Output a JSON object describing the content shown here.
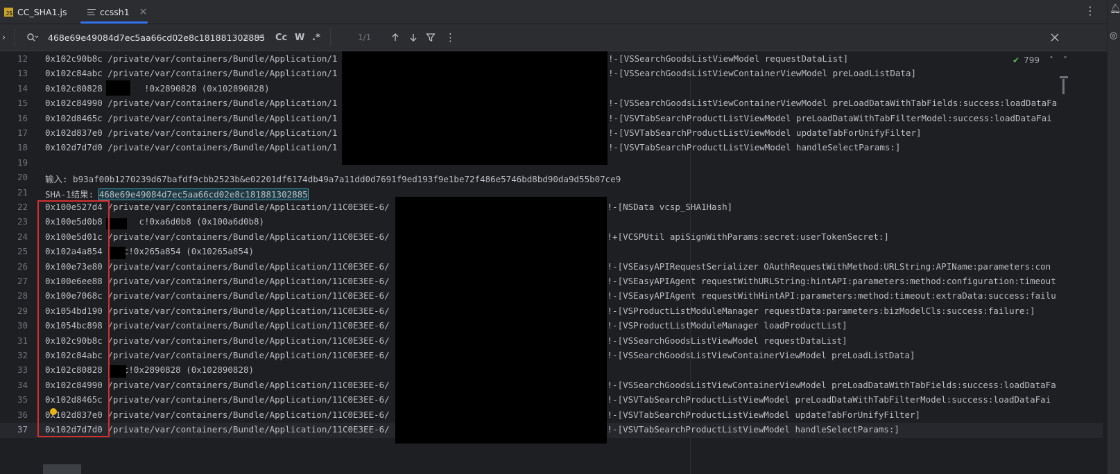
{
  "tabs": [
    {
      "label": "CC_SHA1.js",
      "icon": "js-file-icon",
      "active": false
    },
    {
      "label": "ccssh1",
      "icon": "text-file-icon",
      "active": true
    }
  ],
  "find": {
    "query": "468e69e49084d7ec5aa66cd02e8c181881302885",
    "options": {
      "regex_replace": "↵",
      "case": "Cc",
      "words": "W",
      "regex": ".*"
    },
    "match_count": "1/1"
  },
  "inspection": {
    "count": "799"
  },
  "lines": [
    {
      "n": "12",
      "text": "0x102c90b8c /private/var/containers/Bundle/Application/1",
      "tail": "!-[VSSearchGoodsListViewModel requestDataList]"
    },
    {
      "n": "13",
      "text": "0x102c84abc /private/var/containers/Bundle/Application/1",
      "tail": "!-[VSSearchGoodsListViewContainerViewModel preLoadListData]"
    },
    {
      "n": "14",
      "text": "0x102c80828        !0x2890828 (0x102890828)",
      "tail": ""
    },
    {
      "n": "15",
      "text": "0x102c84990 /private/var/containers/Bundle/Application/1",
      "tail": "!-[VSSearchGoodsListViewContainerViewModel preLoadDataWithTabFields:success:loadDataFa"
    },
    {
      "n": "16",
      "text": "0x102d8465c /private/var/containers/Bundle/Application/1",
      "tail": "!-[VSVTabSearchProductListViewModel preLoadDataWithTabFilterModel:success:loadDataFai"
    },
    {
      "n": "17",
      "text": "0x102d837e0 /private/var/containers/Bundle/Application/1",
      "tail": "!-[VSVTabSearchProductListViewModel updateTabForUnifyFilter]"
    },
    {
      "n": "18",
      "text": "0x102d7d7d0 /private/var/containers/Bundle/Application/1",
      "tail": "!-[VSVTabSearchProductListViewModel handleSelectParams:]"
    },
    {
      "n": "19",
      "text": "",
      "tail": ""
    },
    {
      "n": "20",
      "text": "输入: b93af00b1270239d67bafdf9cbb2523b&e02201df6174db49a7a11dd0d7691f9ed193f9e1be72f486e5746bd8bd90da9d55b07ce9",
      "tail": ""
    },
    {
      "n": "21",
      "text": "SHA-1结果: ",
      "hit": "468e69e49084d7ec5aa66cd02e8c181881302885",
      "tail": ""
    },
    {
      "n": "22",
      "text": "0x100e527d4 /private/var/containers/Bundle/Application/11C0E3EE-6/",
      "tail": "c!-[NSData vcsp_SHA1Hash]"
    },
    {
      "n": "23",
      "text": "0x100e5d0b8       c!0xa6d0b8 (0x100a6d0b8)",
      "tail": ""
    },
    {
      "n": "24",
      "text": "0x100e5d01c /private/var/containers/Bundle/Application/11C0E3EE-6/",
      "tail": "c!+[VCSPUtil apiSignWithParams:secret:userTokenSecret:]"
    },
    {
      "n": "25",
      "text": "0x102a4a854    c!0x265a854 (0x10265a854)",
      "tail": ""
    },
    {
      "n": "26",
      "text": "0x100e73e80 /private/var/containers/Bundle/Application/11C0E3EE-6/",
      "tail": "c!-[VSEasyAPIRequestSerializer OAuthRequestWithMethod:URLString:APIName:parameters:con"
    },
    {
      "n": "27",
      "text": "0x100e6ee88 /private/var/containers/Bundle/Application/11C0E3EE-6/",
      "tail": "c!-[VSEasyAPIAgent requestWithURLString:hintAPI:parameters:method:configuration:timeout"
    },
    {
      "n": "28",
      "text": "0x100e7068c /private/var/containers/Bundle/Application/11C0E3EE-6/",
      "tail": "c!-[VSEasyAPIAgent requestWithHintAPI:parameters:method:timeout:extraData:success:failu"
    },
    {
      "n": "29",
      "text": "0x1054bd190 /private/var/containers/Bundle/Application/11C0E3EE-6/",
      "tail": "c!-[VSProductListModuleManager requestData:parameters:bizModelCls:success:failure:]"
    },
    {
      "n": "30",
      "text": "0x1054bc898 /private/var/containers/Bundle/Application/11C0E3EE-6/",
      "tail": "c!-[VSProductListModuleManager loadProductList]"
    },
    {
      "n": "31",
      "text": "0x102c90b8c /private/var/containers/Bundle/Application/11C0E3EE-6/",
      "tail": "c!-[VSSearchGoodsListViewModel requestDataList]"
    },
    {
      "n": "32",
      "text": "0x102c84abc /private/var/containers/Bundle/Application/11C0E3EE-6/",
      "tail": "c!-[VSSearchGoodsListViewContainerViewModel preLoadListData]"
    },
    {
      "n": "33",
      "text": "0x102c80828    c!0x2890828 (0x102890828)",
      "tail": ""
    },
    {
      "n": "34",
      "text": "0x102c84990 /private/var/containers/Bundle/Application/11C0E3EE-6/",
      "tail": "c!-[VSSearchGoodsListViewContainerViewModel preLoadDataWithTabFields:success:loadDataFa"
    },
    {
      "n": "35",
      "text": "0x102d8465c /private/var/containers/Bundle/Application/11C0E3EE-6/",
      "tail": "c!-[VSVTabSearchProductListViewModel preLoadDataWithTabFilterModel:success:loadDataFai"
    },
    {
      "n": "36",
      "text": "0x102d837e0 /private/var/containers/Bundle/Application/11C0E3EE-6/",
      "tail": "c!-[VSVTabSearchProductListViewModel updateTabForUnifyFilter]"
    },
    {
      "n": "37",
      "text": "0x102d7d7d0 /private/var/containers/Bundle/Application/11C0E3EE-6/",
      "tail": "c!-[VSVTabSearchProductListViewModel handleSelectParams:]"
    }
  ]
}
